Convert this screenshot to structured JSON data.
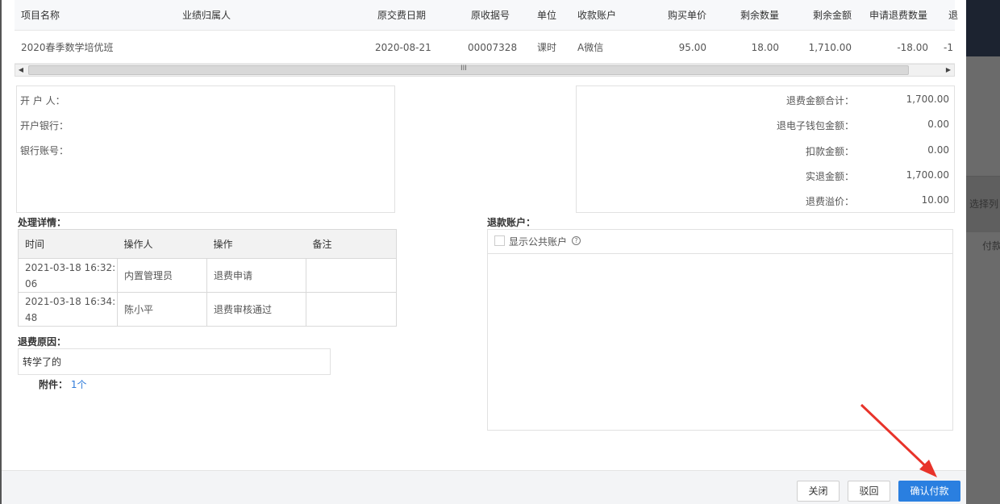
{
  "background": {
    "side_labels": [
      "选择列",
      "付款"
    ]
  },
  "grid": {
    "columns": [
      "项目名称",
      "业绩归属人",
      "原交费日期",
      "原收据号",
      "单位",
      "收款账户",
      "购买单价",
      "剩余数量",
      "剩余金额",
      "申请退费数量",
      "退"
    ],
    "row": [
      "2020春季数学培优班",
      "",
      "2020-08-21",
      "00007328",
      "课时",
      "A微信",
      "95.00",
      "18.00",
      "1,710.00",
      "-18.00",
      "-1"
    ],
    "scroll_grip": "III"
  },
  "bank": {
    "holder_label": "开 户 人：",
    "bank_label": "开户银行：",
    "account_label": "银行账号："
  },
  "totals": [
    {
      "label": "退费金额合计：",
      "value": "1,700.00"
    },
    {
      "label": "退电子钱包金额：",
      "value": "0.00"
    },
    {
      "label": "扣款金额：",
      "value": "0.00"
    },
    {
      "label": "实退金额：",
      "value": "1,700.00"
    },
    {
      "label": "退费溢价：",
      "value": "10.00"
    }
  ],
  "process": {
    "title": "处理详情：",
    "columns": [
      "时间",
      "操作人",
      "操作",
      "备注"
    ],
    "rows": [
      {
        "time": "2021-03-18 16:32:06",
        "operator": "内置管理员",
        "action": "退费申请",
        "note": ""
      },
      {
        "time": "2021-03-18 16:34:48",
        "operator": "陈小平",
        "action": "退费审核通过",
        "note": ""
      }
    ]
  },
  "reason": {
    "title": "退费原因：",
    "value": "转学了的",
    "attachment_label": "附件：",
    "attachment_link": "1个"
  },
  "refund_account": {
    "title": "退款账户：",
    "show_public_label": "显示公共账户",
    "help_icon": "?"
  },
  "footer": {
    "close": "关闭",
    "reject": "驳回",
    "confirm": "确认付款"
  },
  "colors": {
    "primary": "#2a7fe0",
    "link": "#2f7bd9",
    "annotation_arrow": "#e8332a"
  }
}
